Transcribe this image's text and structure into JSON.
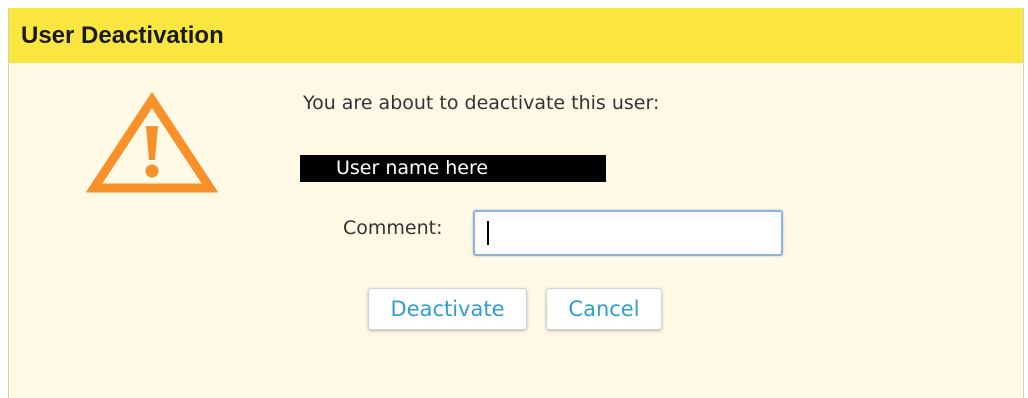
{
  "dialog": {
    "title": "User Deactivation",
    "message": "You are about to deactivate this user:",
    "username": "User name here",
    "comment_label": "Comment:",
    "comment_value": "",
    "buttons": {
      "deactivate": "Deactivate",
      "cancel": "Cancel"
    },
    "icon": "warning-triangle-icon"
  },
  "colors": {
    "title_bar": "#fae63e",
    "dialog_background": "#fff9e6",
    "warning_icon": "#f7922a",
    "button_text": "#2f9fd0"
  }
}
